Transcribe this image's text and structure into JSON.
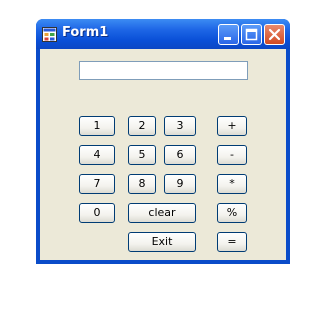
{
  "window": {
    "title": "Form1"
  },
  "display": {
    "value": ""
  },
  "buttons": {
    "b1": "1",
    "b2": "2",
    "b3": "3",
    "b4": "4",
    "b5": "5",
    "b6": "6",
    "b7": "7",
    "b8": "8",
    "b9": "9",
    "b0": "0",
    "plus": "+",
    "minus": "-",
    "multiply": "*",
    "percent": "%",
    "equals": "=",
    "clear": "clear",
    "exit": "Exit"
  },
  "icons": {
    "app": "app-form-icon",
    "minimize": "minimize-icon",
    "maximize": "maximize-icon",
    "close": "close-icon"
  }
}
